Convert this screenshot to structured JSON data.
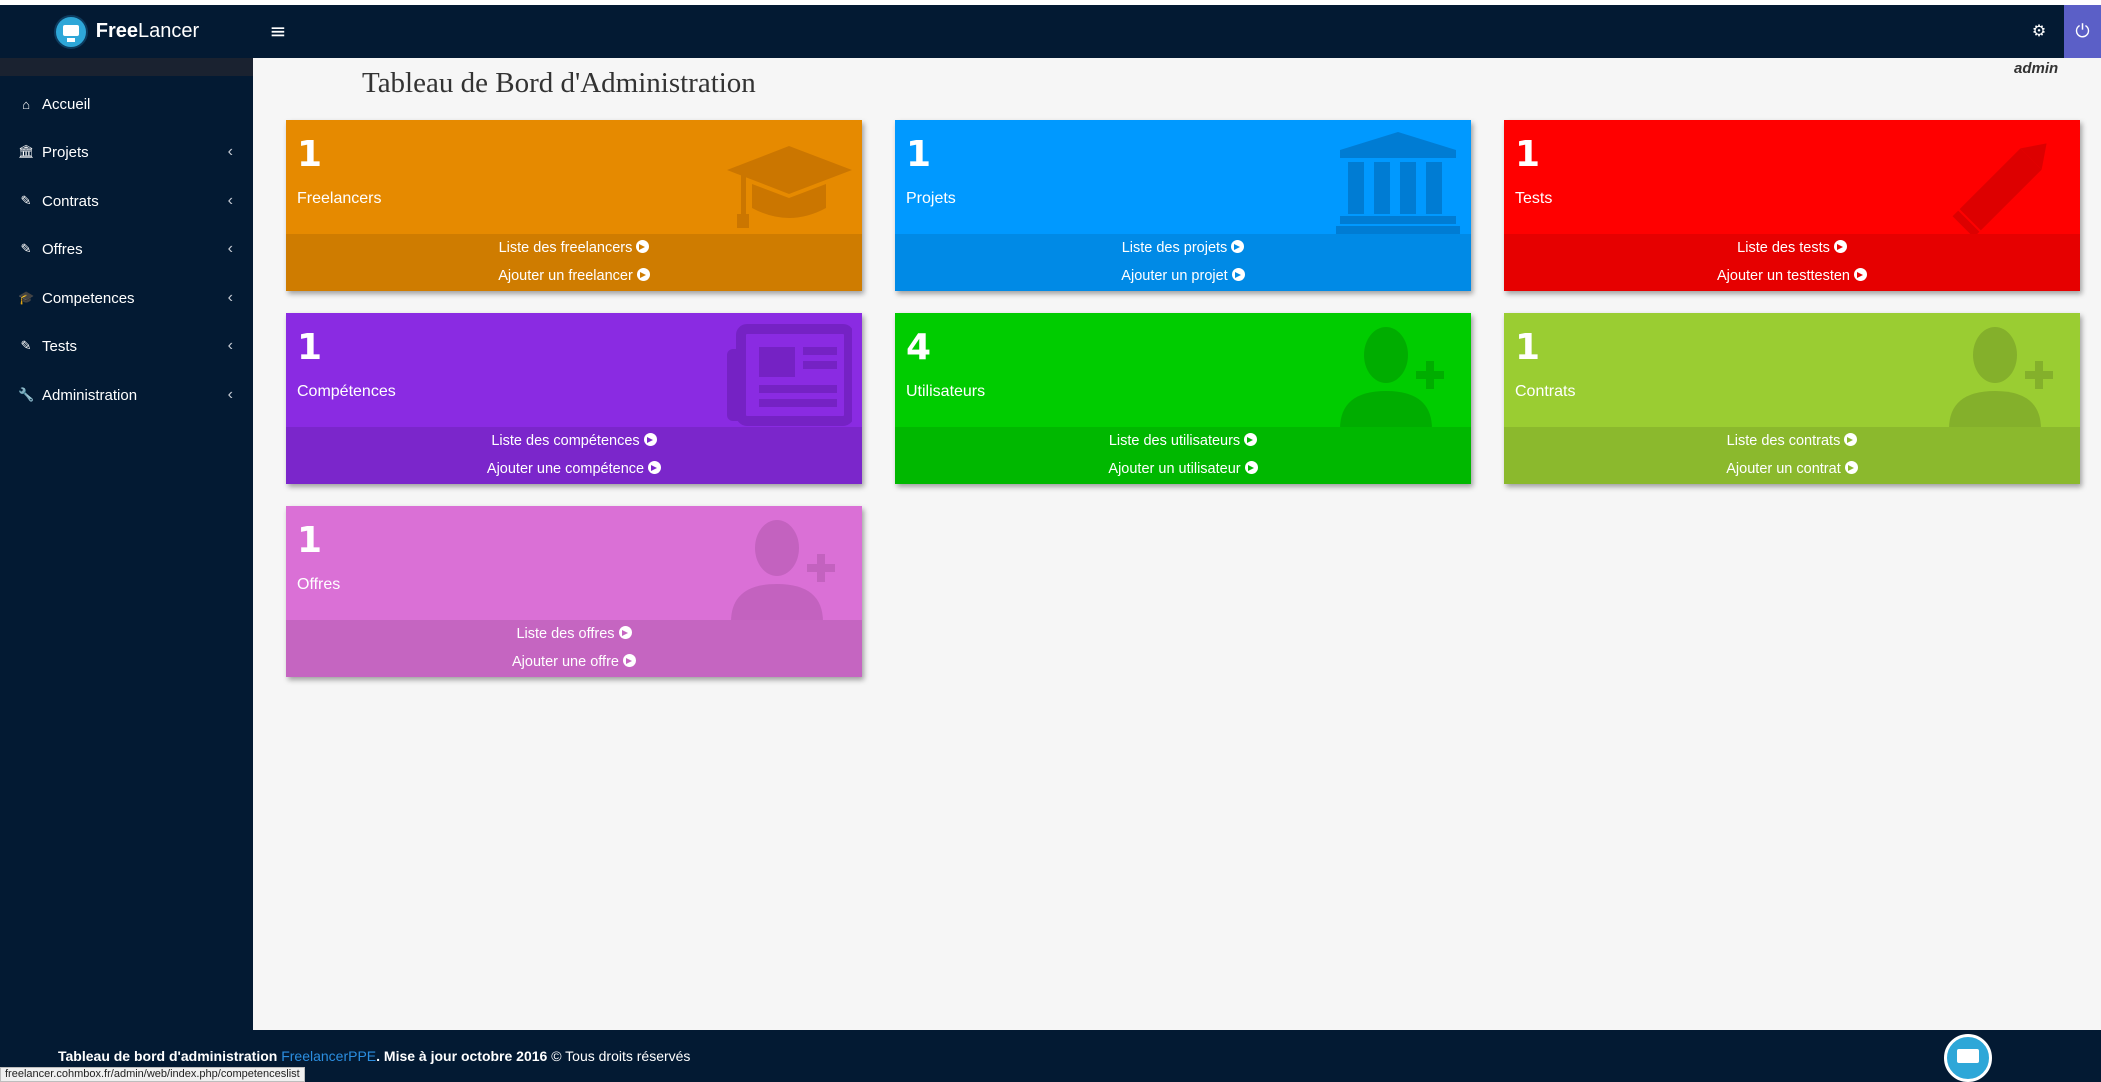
{
  "brand": {
    "name_bold": "Free",
    "name_rest": "Lancer"
  },
  "header": {
    "menu_icon": "hamburger-icon",
    "settings_icon": "cogs-icon",
    "power_icon": "power-icon",
    "user": "admin"
  },
  "page_title": "Tableau de Bord d'Administration",
  "sidebar": {
    "items": [
      {
        "label": "Accueil",
        "icon": "home-icon",
        "has_children": false
      },
      {
        "label": "Projets",
        "icon": "bank-icon",
        "has_children": true
      },
      {
        "label": "Contrats",
        "icon": "pencil-icon",
        "has_children": true
      },
      {
        "label": "Offres",
        "icon": "pencil-icon",
        "has_children": true
      },
      {
        "label": "Competences",
        "icon": "graduation-cap-icon",
        "has_children": true
      },
      {
        "label": "Tests",
        "icon": "pencil-icon",
        "has_children": true
      },
      {
        "label": "Administration",
        "icon": "wrench-icon",
        "has_children": true
      }
    ],
    "chevron": "‹"
  },
  "cards": [
    {
      "count": "1",
      "label": "Freelancers",
      "link1": "Liste des freelancers",
      "link2": "Ajouter un freelancer",
      "icon": "graduation-cap-icon",
      "color": "#e68a00",
      "footer_color": "#cf7c00",
      "icon_color": "#c77300"
    },
    {
      "count": "1",
      "label": "Projets",
      "link1": "Liste des projets",
      "link2": "Ajouter un projet",
      "icon": "bank-icon",
      "color": "#0099ff",
      "footer_color": "#008ae6",
      "icon_color": "#0077cc"
    },
    {
      "count": "1",
      "label": "Tests",
      "link1": "Liste des tests",
      "link2": "Ajouter un testtesten",
      "icon": "pencil-icon",
      "color": "#ff0000",
      "footer_color": "#e60000",
      "icon_color": "#d80000"
    },
    {
      "count": "1",
      "label": "Compétences",
      "link1": "Liste des compétences",
      "link2": "Ajouter une compétence",
      "icon": "newspaper-icon",
      "color": "#8a2be2",
      "footer_color": "#7b26cb",
      "icon_color": "#7221bf"
    },
    {
      "count": "4",
      "label": "Utilisateurs",
      "link1": "Liste des utilisateurs",
      "link2": "Ajouter un utilisateur",
      "icon": "user-plus-icon",
      "color": "#00cc00",
      "footer_color": "#00b800",
      "icon_color": "#00a800"
    },
    {
      "count": "1",
      "label": "Contrats",
      "link1": "Liste des contrats",
      "link2": "Ajouter un contrat",
      "icon": "user-plus-icon",
      "color": "#9acd32",
      "footer_color": "#8bb92d",
      "icon_color": "#81ab2a"
    },
    {
      "count": "1",
      "label": "Offres",
      "link1": "Liste des offres",
      "link2": "Ajouter une offre",
      "icon": "user-plus-icon",
      "color": "#da70d6",
      "footer_color": "#c565c1",
      "icon_color": "#c060bc"
    }
  ],
  "footer": {
    "prefix": "Tableau de bord d'administration ",
    "brand": "FreelancerPPE",
    "updated": ". Mise à jour octobre 2016",
    "rights": " © Tous droits réservés"
  },
  "status_url": "freelancer.cohmbox.fr/admin/web/index.php/competenceslist"
}
